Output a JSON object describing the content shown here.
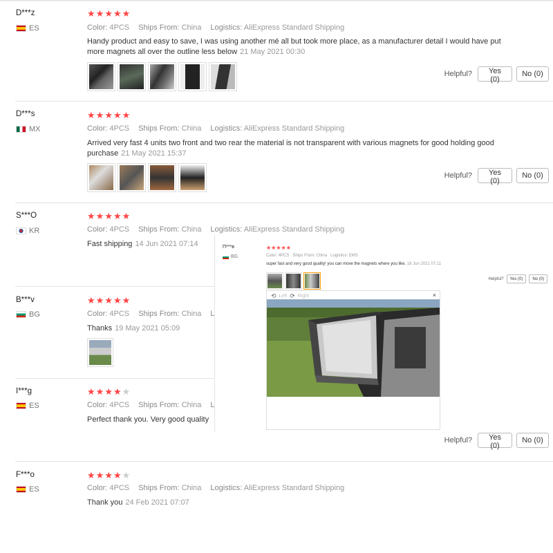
{
  "reviews": [
    {
      "user": "D***z",
      "country": "ES",
      "stars": 5,
      "color_label": "Color:",
      "color_value": "4PCS",
      "ships_label": "Ships From:",
      "ships_value": "China",
      "logistics_label": "Logistics:",
      "logistics_value": "AliExpress Standard Shipping",
      "text": "Handy product and easy to save, I was using another mé all but took more place, as a manufacturer detail I would have put more magnets all over the outline less below",
      "date": "21 May 2021 00:30",
      "thumb_count": 5,
      "yes": "Yes (0)",
      "no": "No (0)"
    },
    {
      "user": "D***s",
      "country": "MX",
      "stars": 5,
      "color_label": "Color:",
      "color_value": "4PCS",
      "ships_label": "Ships From:",
      "ships_value": "China",
      "logistics_label": "Logistics:",
      "logistics_value": "AliExpress Standard Shipping",
      "text": "Arrived very fast 4 units two front and two rear the material is not transparent with various magnets for good holding good purchase",
      "date": "21 May 2021 15:37",
      "thumb_count": 4,
      "yes": "Yes (0)",
      "no": "No (0)"
    },
    {
      "user": "S***O",
      "country": "KR",
      "stars": 5,
      "color_label": "Color:",
      "color_value": "4PCS",
      "ships_label": "Ships From:",
      "ships_value": "China",
      "logistics_label": "Logistics:",
      "logistics_value": "AliExpress Standard Shipping",
      "text": "Fast shipping",
      "date": "14 Jun 2021 07:14"
    },
    {
      "user": "B***v",
      "country": "BG",
      "stars": 5,
      "color_label": "Color:",
      "color_value": "4PCS",
      "ships_label": "Ships From:",
      "ships_value": "China",
      "logistics_label": "Lo",
      "text": "Thanks",
      "date": "19 May 2021 05:09",
      "thumb_count": 1
    },
    {
      "user": "I***g",
      "country": "ES",
      "stars": 4,
      "color_label": "Color:",
      "color_value": "4PCS",
      "ships_label": "Ships From:",
      "ships_value": "China",
      "logistics_label": "Lo",
      "text": "Perfect thank you. Very good quality",
      "yes": "Yes (0)",
      "no": "No (0)"
    },
    {
      "user": "F***o",
      "country": "ES",
      "stars": 4,
      "color_label": "Color:",
      "color_value": "4PCS",
      "ships_label": "Ships From:",
      "ships_value": "China",
      "logistics_label": "Logistics:",
      "logistics_value": "AliExpress Standard Shipping",
      "text": "Thank you",
      "date": "24 Feb 2021 07:07"
    }
  ],
  "helpful_label": "Helpful?",
  "overlay": {
    "user": "П***в",
    "country": "BG",
    "stars": 5,
    "color_label": "Color:",
    "color_value": "4PCS",
    "ships_label": "Ships From:",
    "ships_value": "China",
    "logistics_label": "Logistics:",
    "logistics_value": "EMS",
    "text": "super fast and very good quality! you can move the magnets where you like.",
    "date": "18 Jun 2021 07:11",
    "helpful_label": "Helpful?",
    "yes": "Yes (0)",
    "no": "No (0)",
    "viewer": {
      "left_label": "Left",
      "right_label": "Right",
      "close": "×"
    }
  },
  "colors": {
    "star": "#ff4747",
    "star_empty": "#cccccc",
    "border": "#e3e3e3"
  },
  "icons": {
    "rotate_left": "rotate-left-icon",
    "rotate_right": "rotate-right-icon",
    "close": "close-icon"
  }
}
